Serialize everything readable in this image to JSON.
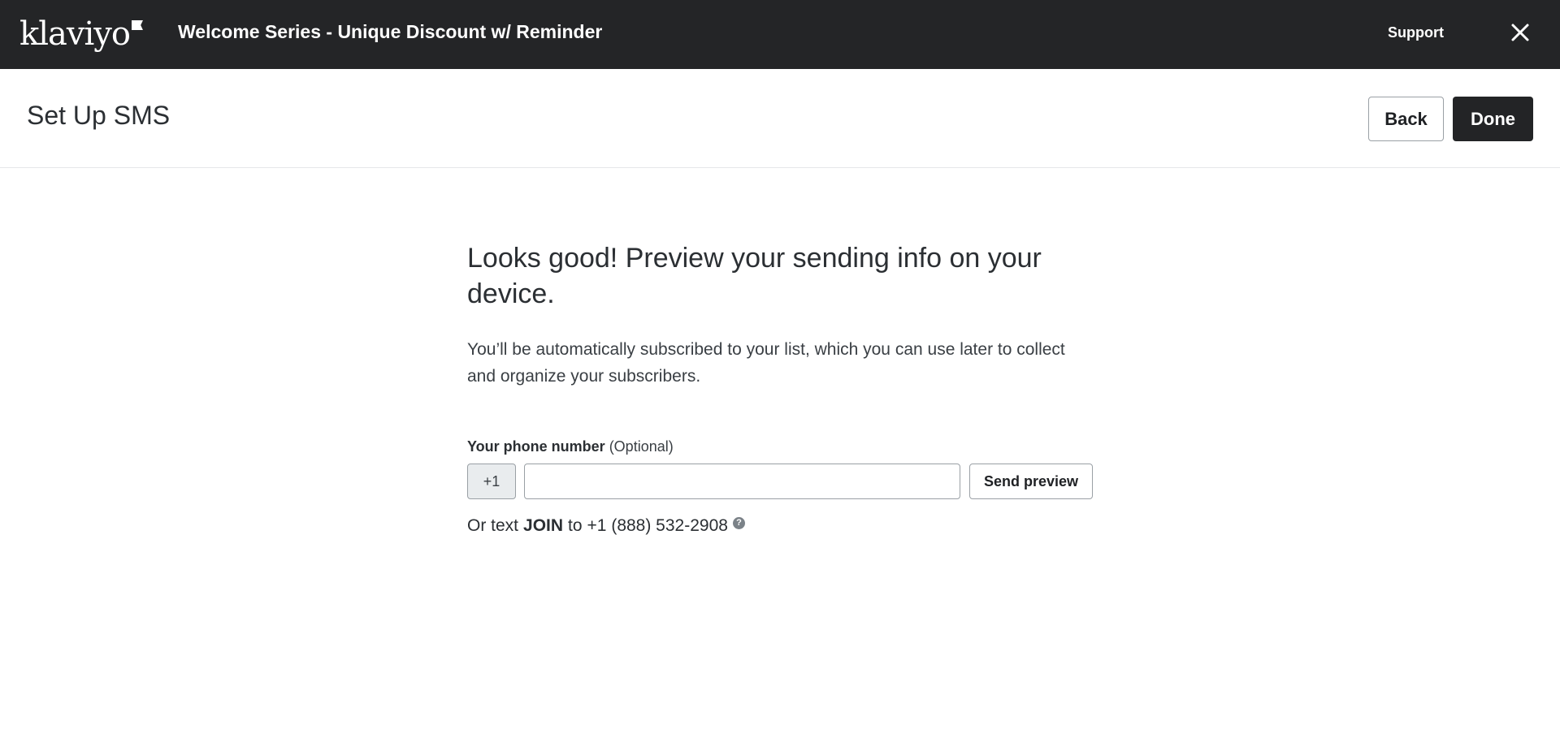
{
  "topbar": {
    "logo_text": "klaviyo",
    "flow_title": "Welcome Series - Unique Discount w/ Reminder",
    "support_label": "Support",
    "close_icon": "close-icon"
  },
  "subheader": {
    "page_title": "Set Up SMS",
    "back_label": "Back",
    "done_label": "Done"
  },
  "main": {
    "heading": "Looks good! Preview your sending info on your device.",
    "description": "You’ll be automatically subscribed to your list, which you can use later to collect and organize your subscribers.",
    "phone_label": "Your phone number",
    "phone_label_optional": "(Optional)",
    "country_code": "+1",
    "phone_value": "",
    "phone_placeholder": "",
    "send_preview_label": "Send preview",
    "alt_prefix": "Or text",
    "alt_keyword": "JOIN",
    "alt_middle": "to",
    "alt_number": "+1 (888) 532-2908",
    "help_icon": "question-circle-icon"
  },
  "colors": {
    "topbar_bg": "#242527",
    "done_bg": "#232426",
    "text": "#2b2f33"
  }
}
